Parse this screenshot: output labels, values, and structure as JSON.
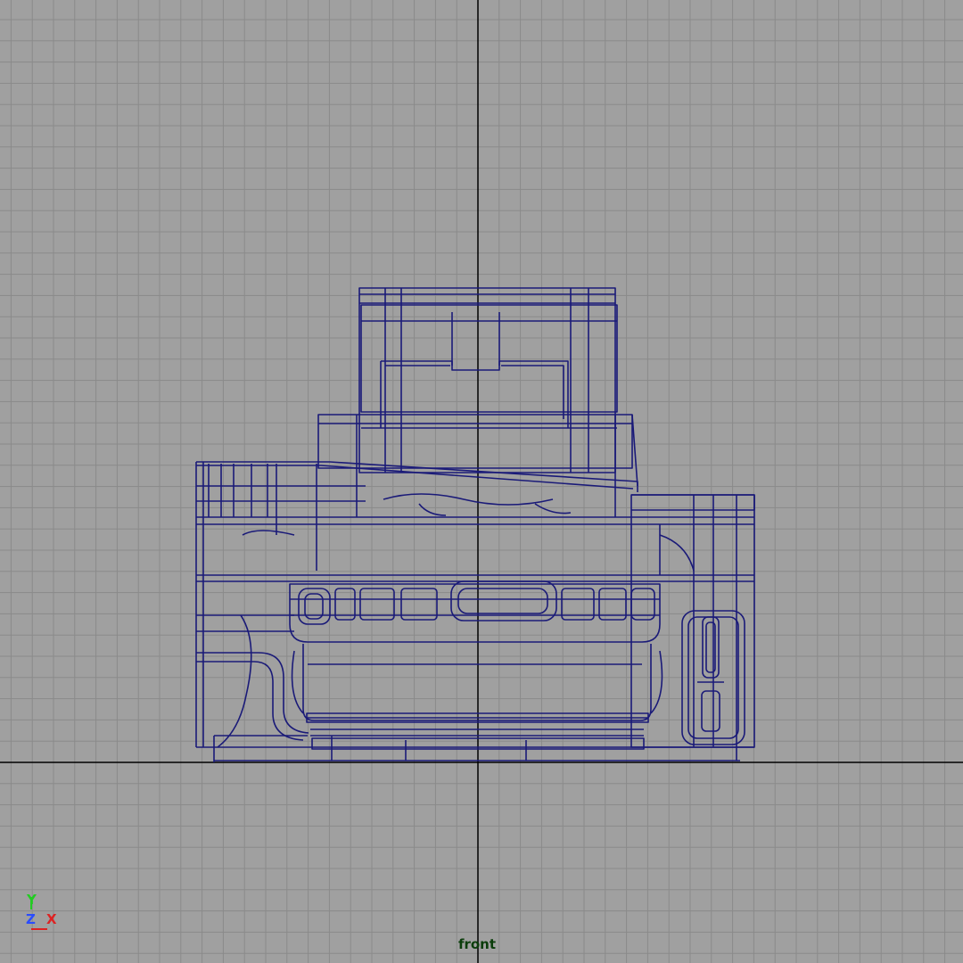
{
  "viewport": {
    "camera_name": "front",
    "colors": {
      "background": "#a0a0a0",
      "grid": "#8a8a8a",
      "axis": "#000000",
      "wireframe": "#1a1a78",
      "label": "#0b3d0b"
    }
  },
  "axis_indicator": {
    "y_label": "Y",
    "z_label": "Z",
    "x_label": "X",
    "y_color": "#22cc22",
    "z_color": "#2a4cff",
    "x_color": "#dd2222"
  }
}
